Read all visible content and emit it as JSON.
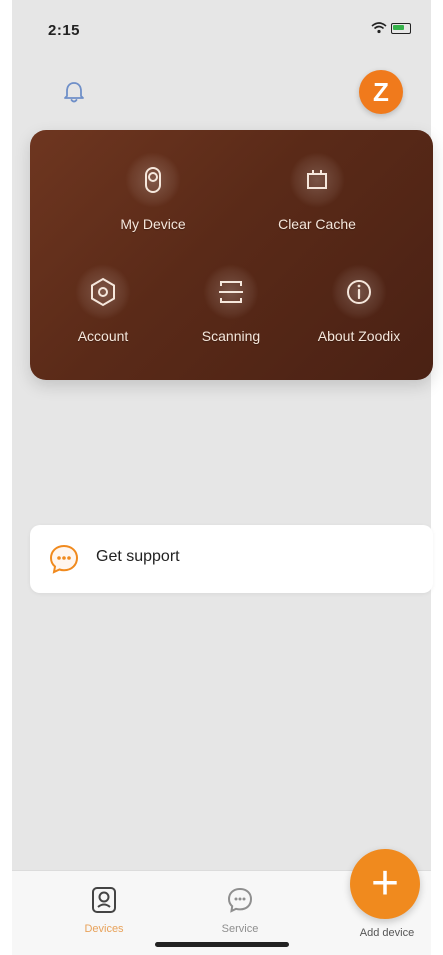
{
  "status_bar": {
    "time": "2:15"
  },
  "header": {
    "avatar_letter": "Z",
    "avatar_color": "#f07a1c"
  },
  "menu": {
    "items": [
      {
        "label": "My Device",
        "icon": "device-icon"
      },
      {
        "label": "Clear Cache",
        "icon": "clear-cache-icon"
      },
      {
        "label": "Account",
        "icon": "account-icon"
      },
      {
        "label": "Scanning",
        "icon": "scanning-icon"
      },
      {
        "label": "About Zoodix",
        "icon": "about-icon"
      }
    ],
    "card_color": "#5a2a18"
  },
  "support": {
    "label": "Get support"
  },
  "bottom_nav": {
    "devices": {
      "label": "Devices",
      "active": true,
      "color": "#e8a25a"
    },
    "service": {
      "label": "Service"
    },
    "add": {
      "label": "Add device",
      "color": "#f08a1e"
    }
  }
}
